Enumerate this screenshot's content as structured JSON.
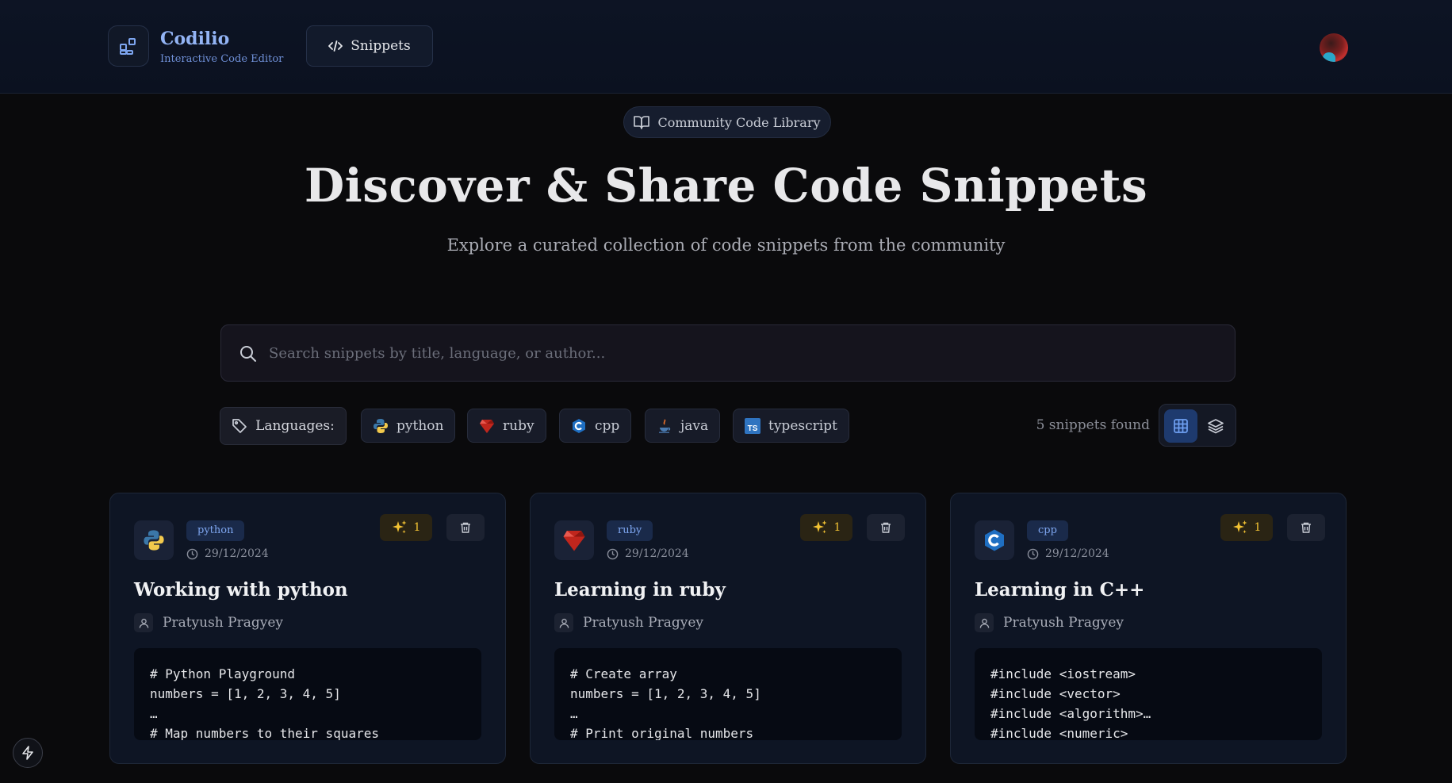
{
  "header": {
    "brand_name": "Codilio",
    "brand_tagline": "Interactive Code Editor",
    "nav_snippets": "Snippets"
  },
  "hero": {
    "badge": "Community Code Library",
    "title": "Discover & Share Code Snippets",
    "subtitle": "Explore a curated collection of code snippets from the community"
  },
  "search": {
    "placeholder": "Search snippets by title, language, or author..."
  },
  "filters": {
    "label": "Languages:",
    "languages": [
      {
        "name": "python",
        "icon": "python-icon"
      },
      {
        "name": "ruby",
        "icon": "ruby-icon"
      },
      {
        "name": "cpp",
        "icon": "cpp-icon"
      },
      {
        "name": "java",
        "icon": "java-icon"
      },
      {
        "name": "typescript",
        "icon": "typescript-icon"
      }
    ],
    "results_count": "5 snippets found",
    "view_mode": "grid"
  },
  "snippets": [
    {
      "language": "python",
      "date": "29/12/2024",
      "stars": "1",
      "title": "Working with python",
      "author": "Pratyush Pragyey",
      "code": [
        "# Python Playground",
        "numbers = [1, 2, 3, 4, 5]",
        "…",
        "# Map numbers to their squares"
      ]
    },
    {
      "language": "ruby",
      "date": "29/12/2024",
      "stars": "1",
      "title": "Learning in ruby",
      "author": "Pratyush Pragyey",
      "code": [
        "# Create array",
        "numbers = [1, 2, 3, 4, 5]",
        "…",
        "# Print original numbers"
      ]
    },
    {
      "language": "cpp",
      "date": "29/12/2024",
      "stars": "1",
      "title": "Learning in C++",
      "author": "Pratyush Pragyey",
      "code": [
        "#include <iostream>",
        "#include <vector>",
        "#include <algorithm>…",
        "#include <numeric>"
      ]
    }
  ],
  "colors": {
    "accent": "#93b4f5",
    "background": "#0a0a0c",
    "star": "#f2c233"
  }
}
